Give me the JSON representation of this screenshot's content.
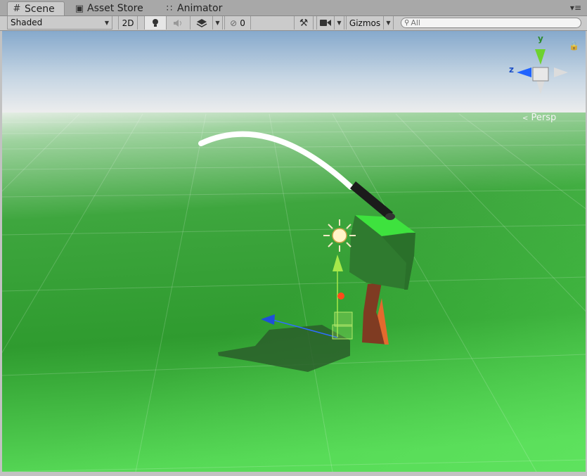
{
  "tabs": [
    {
      "label": "Scene",
      "icon": "grid-icon",
      "active": true
    },
    {
      "label": "Asset Store",
      "icon": "store-icon",
      "active": false
    },
    {
      "label": "Animator",
      "icon": "animator-icon",
      "active": false
    }
  ],
  "toolbar": {
    "draw_mode": "Shaded",
    "mode_2d": "2D",
    "lighting_icon": "lightbulb-icon",
    "audio_icon": "speaker-icon",
    "effects_icon": "layers-icon",
    "hidden_count": "0",
    "tools_icon": "wrench-icon",
    "camera_icon": "camera-icon",
    "gizmos_label": "Gizmos",
    "search_placeholder": "All"
  },
  "scene": {
    "projection_label": "Persp",
    "axis_y_label": "y",
    "axis_z_label": "z"
  },
  "colors": {
    "sky_top": "#8fb0cf",
    "horizon": "#f0f0f0",
    "ground_near": "#5fe05f",
    "ground_far": "#2a9a2a",
    "cube_top": "#3fe03f",
    "cube_side": "#2d7d2d",
    "trunk": "#8a3e22",
    "selection": "#a8e06a"
  }
}
